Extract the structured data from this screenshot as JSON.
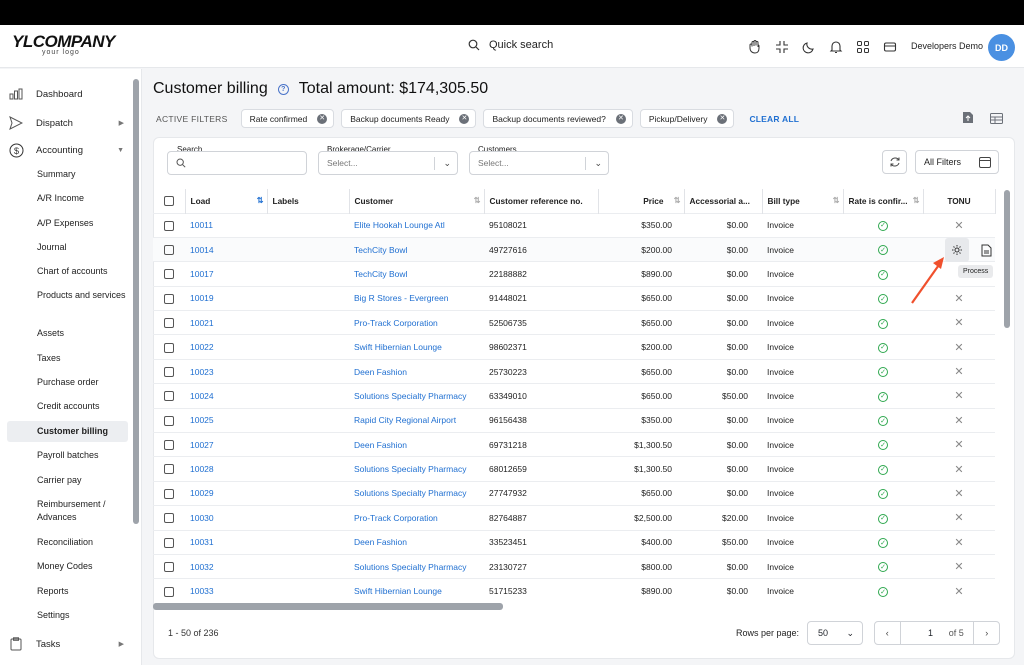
{
  "header": {
    "logo_brand": "YLCOMPANY",
    "logo_sub": "your logo",
    "search_label": "Quick search",
    "user_name": "Developers Demo",
    "avatar_initials": "DD"
  },
  "sidebar": {
    "top_items": [
      {
        "label": "Dashboard",
        "icon": "bar-chart-icon"
      },
      {
        "label": "Dispatch",
        "icon": "send-icon"
      },
      {
        "label": "Accounting",
        "icon": "dollar-icon"
      }
    ],
    "accounting_items": [
      "Summary",
      "A/R Income",
      "A/P Expenses",
      "Journal",
      "Chart of accounts",
      "Products and services",
      "Assets",
      "Taxes",
      "Purchase order",
      "Credit accounts",
      "Customer billing",
      "Payroll batches",
      "Carrier pay",
      "Reimbursement / Advances",
      "Reconciliation",
      "Money Codes",
      "Reports",
      "Settings"
    ],
    "tasks_label": "Tasks"
  },
  "page": {
    "title": "Customer billing",
    "total_label": "Total amount: $174,305.50"
  },
  "filters": {
    "label": "ACTIVE FILTERS",
    "chips": [
      "Rate confirmed",
      "Backup documents Ready",
      "Backup documents reviewed?",
      "Pickup/Delivery"
    ],
    "clear_all": "CLEAR ALL"
  },
  "search": {
    "search_label": "Search",
    "brokerage_label": "Brokerage/Carrier",
    "brokerage_placeholder": "Select...",
    "customers_label": "Customers",
    "customers_placeholder": "Select...",
    "all_filters": "All Filters"
  },
  "table": {
    "columns": [
      "Load",
      "Labels",
      "Customer",
      "Customer reference no.",
      "Price",
      "Accessorial a...",
      "Bill type",
      "Rate is confir...",
      "TONU"
    ],
    "rows": [
      {
        "load": "10011",
        "customer": "Elite Hookah Lounge Atl",
        "ref": "95108021",
        "price": "$350.00",
        "acc": "$0.00",
        "bill": "Invoice",
        "rate": true,
        "tonu": "x"
      },
      {
        "load": "10014",
        "customer": "TechCity Bowl",
        "ref": "49727616",
        "price": "$200.00",
        "acc": "$0.00",
        "bill": "Invoice",
        "rate": true,
        "tonu": ""
      },
      {
        "load": "10017",
        "customer": "TechCity Bowl",
        "ref": "22188882",
        "price": "$890.00",
        "acc": "$0.00",
        "bill": "Invoice",
        "rate": true,
        "tonu": ""
      },
      {
        "load": "10019",
        "customer": "Big R Stores - Evergreen",
        "ref": "91448021",
        "price": "$650.00",
        "acc": "$0.00",
        "bill": "Invoice",
        "rate": true,
        "tonu": "x"
      },
      {
        "load": "10021",
        "customer": "Pro-Track Corporation",
        "ref": "52506735",
        "price": "$650.00",
        "acc": "$0.00",
        "bill": "Invoice",
        "rate": true,
        "tonu": "x"
      },
      {
        "load": "10022",
        "customer": "Swift Hibernian Lounge",
        "ref": "98602371",
        "price": "$200.00",
        "acc": "$0.00",
        "bill": "Invoice",
        "rate": true,
        "tonu": "x"
      },
      {
        "load": "10023",
        "customer": "Deen Fashion",
        "ref": "25730223",
        "price": "$650.00",
        "acc": "$0.00",
        "bill": "Invoice",
        "rate": true,
        "tonu": "x"
      },
      {
        "load": "10024",
        "customer": "Solutions Specialty Pharmacy",
        "ref": "63349010",
        "price": "$650.00",
        "acc": "$50.00",
        "bill": "Invoice",
        "rate": true,
        "tonu": "x"
      },
      {
        "load": "10025",
        "customer": "Rapid City Regional Airport",
        "ref": "96156438",
        "price": "$350.00",
        "acc": "$0.00",
        "bill": "Invoice",
        "rate": true,
        "tonu": "x"
      },
      {
        "load": "10027",
        "customer": "Deen Fashion",
        "ref": "69731218",
        "price": "$1,300.50",
        "acc": "$0.00",
        "bill": "Invoice",
        "rate": true,
        "tonu": "x"
      },
      {
        "load": "10028",
        "customer": "Solutions Specialty Pharmacy",
        "ref": "68012659",
        "price": "$1,300.50",
        "acc": "$0.00",
        "bill": "Invoice",
        "rate": true,
        "tonu": "x"
      },
      {
        "load": "10029",
        "customer": "Solutions Specialty Pharmacy",
        "ref": "27747932",
        "price": "$650.00",
        "acc": "$0.00",
        "bill": "Invoice",
        "rate": true,
        "tonu": "x"
      },
      {
        "load": "10030",
        "customer": "Pro-Track Corporation",
        "ref": "82764887",
        "price": "$2,500.00",
        "acc": "$20.00",
        "bill": "Invoice",
        "rate": true,
        "tonu": "x"
      },
      {
        "load": "10031",
        "customer": "Deen Fashion",
        "ref": "33523451",
        "price": "$400.00",
        "acc": "$50.00",
        "bill": "Invoice",
        "rate": true,
        "tonu": "x"
      },
      {
        "load": "10032",
        "customer": "Solutions Specialty Pharmacy",
        "ref": "23130727",
        "price": "$800.00",
        "acc": "$0.00",
        "bill": "Invoice",
        "rate": true,
        "tonu": "x"
      },
      {
        "load": "10033",
        "customer": "Swift Hibernian Lounge",
        "ref": "51715233",
        "price": "$890.00",
        "acc": "$0.00",
        "bill": "Invoice",
        "rate": true,
        "tonu": "x"
      }
    ],
    "tooltip": "Process"
  },
  "footer": {
    "range": "1 - 50 of 236",
    "rows_per_page_label": "Rows per page:",
    "rows_per_page": "50",
    "page": "1",
    "of_pages": "of 5"
  },
  "colors": {
    "link": "#1f6fd1",
    "accent": "#4a90e2",
    "success": "#2fa84f",
    "arrow": "#f0502d"
  }
}
